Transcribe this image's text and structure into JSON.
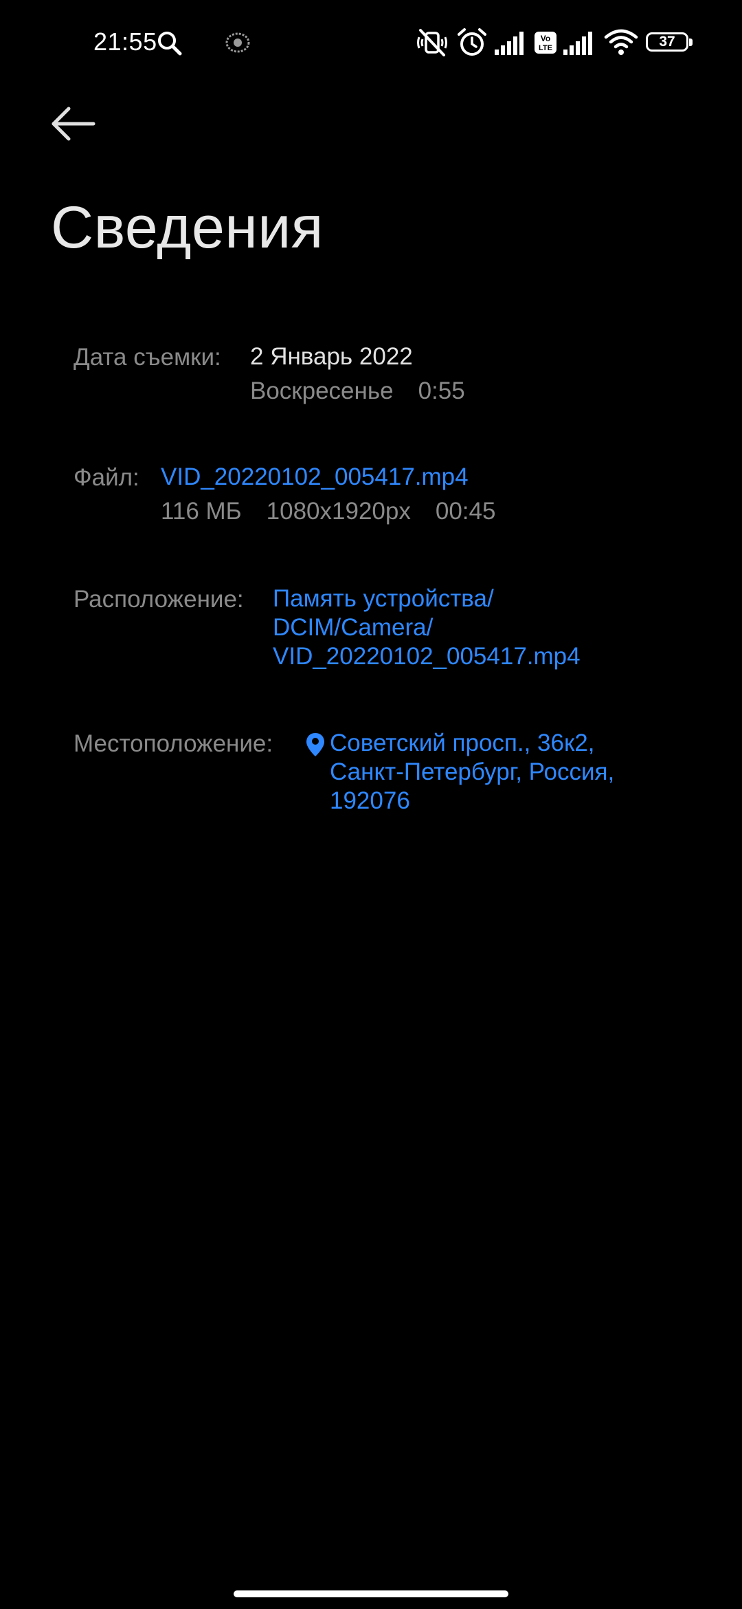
{
  "status_bar": {
    "time": "21:55",
    "battery_level": "37",
    "icons": [
      "search-icon",
      "app-notification-icon",
      "mute-icon",
      "alarm-icon",
      "signal-icon",
      "volte-icon",
      "signal-icon",
      "wifi-icon",
      "battery-icon"
    ]
  },
  "header": {
    "back_icon": "arrow-left-icon",
    "title": "Сведения"
  },
  "details": {
    "capture_date": {
      "label": "Дата съемки:",
      "date": "2 Январь 2022",
      "weekday": "Воскресенье",
      "time": "0:55"
    },
    "file": {
      "label": "Файл:",
      "name": "VID_20220102_005417.mp4",
      "size": "116 МБ",
      "resolution": "1080x1920px",
      "duration": "00:45"
    },
    "path": {
      "label": "Расположение:",
      "line1": "Память устройства/",
      "line2": "DCIM/Camera/",
      "line3": "VID_20220102_005417.mp4"
    },
    "location": {
      "label": "Местоположение:",
      "icon": "map-pin-icon",
      "line1": "Советский просп., 36к2,",
      "line2": "Санкт-Петербург, Россия,",
      "line3": "192076"
    }
  },
  "colors": {
    "background": "#000000",
    "link": "#2f88ff",
    "label": "#8a8a8a",
    "text": "#e2e2e2"
  }
}
